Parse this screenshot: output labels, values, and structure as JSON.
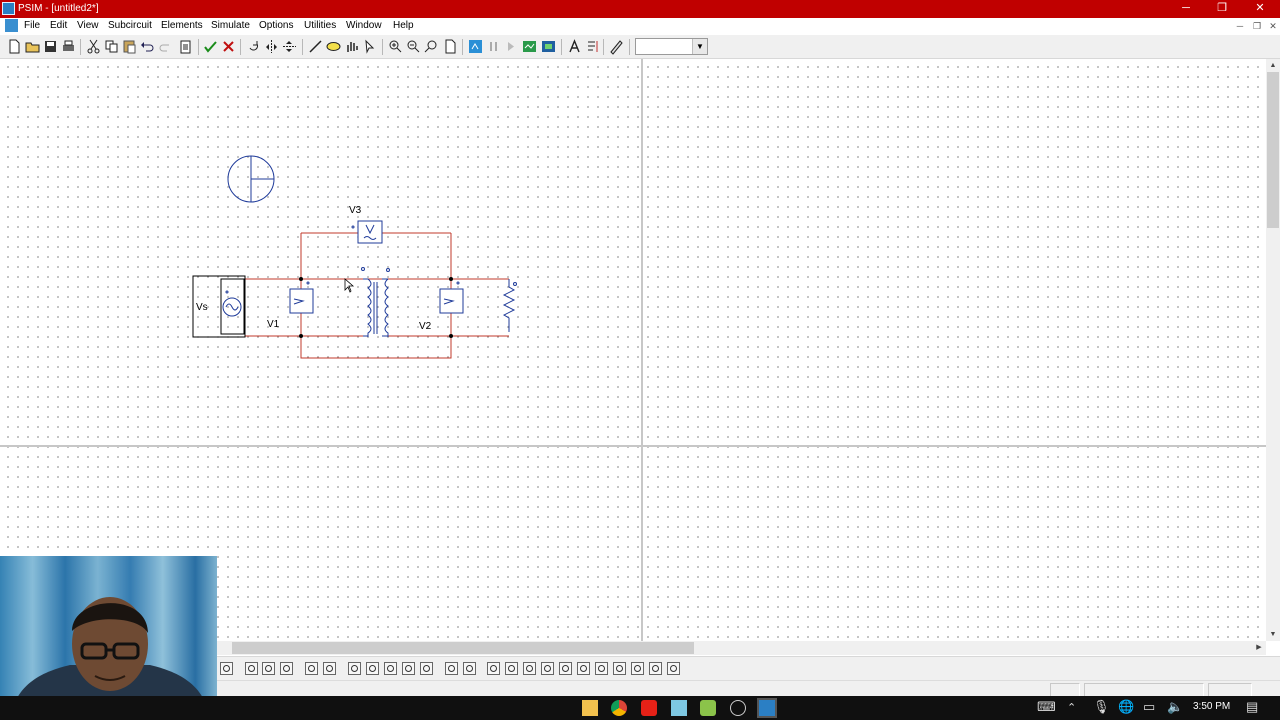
{
  "window": {
    "title": "PSIM - [untitled2*]",
    "minimize_glyph": "─",
    "restore_glyph": "❐",
    "close_glyph": "✕"
  },
  "menu": [
    "File",
    "Edit",
    "View",
    "Subcircuit",
    "Elements",
    "Simulate",
    "Options",
    "Utilities",
    "Window",
    "Help"
  ],
  "toolbar": {
    "buttons": [
      "new-icon",
      "open-icon",
      "save-icon",
      "print-icon",
      "cut-icon",
      "copy-icon",
      "paste-icon",
      "undo-icon",
      "redo-icon",
      "clipboard-icon",
      "check-icon",
      "cross-icon",
      "rotate-icon",
      "flip-lr-icon",
      "flip-tb-icon",
      "wire-icon",
      "label-icon",
      "pan-icon",
      "select-icon",
      "zoom-in-icon",
      "zoom-out-icon",
      "zoom-area-icon",
      "fit-icon",
      "run-simulation-icon",
      "pause-icon",
      "step-icon",
      "simview-icon",
      "simview-alt-icon",
      "text-icon",
      "parameter-icon",
      "eraser-icon"
    ],
    "zoom_combo_value": ""
  },
  "schematic": {
    "labels": {
      "source": "Vs",
      "voltmeter_primary": "V1",
      "voltmeter_secondary": "V2",
      "voltmeter_top": "V3"
    },
    "colors": {
      "wire": "#c0392b",
      "component": "#1f3b9a",
      "outline": "#000000"
    }
  },
  "bottom_toolbar": {
    "buttons": [
      "probe-icon",
      "probe-v-icon",
      "probe-i-icon",
      "probe-p-icon",
      "probe-vv-icon",
      "box-icon",
      "boxcross-icon",
      "source-dc-icon",
      "source-ac-icon",
      "source-sq-icon",
      "source-tri-icon",
      "source-step-icon",
      "switch-icon",
      "diode-icon",
      "resistor-icon",
      "capacitor-icon",
      "inductor-icon",
      "transistor-icon",
      "thyristor-icon",
      "mosfet-icon",
      "igbt-icon",
      "ground-icon",
      "ammeter-icon",
      "meter-icon"
    ]
  },
  "taskbar": {
    "clock": "3:50 PM",
    "apps": [
      "file-explorer-icon",
      "chrome-icon",
      "youtube-icon",
      "notes-icon",
      "android-icon",
      "clock-app-icon",
      "psim-icon"
    ]
  }
}
